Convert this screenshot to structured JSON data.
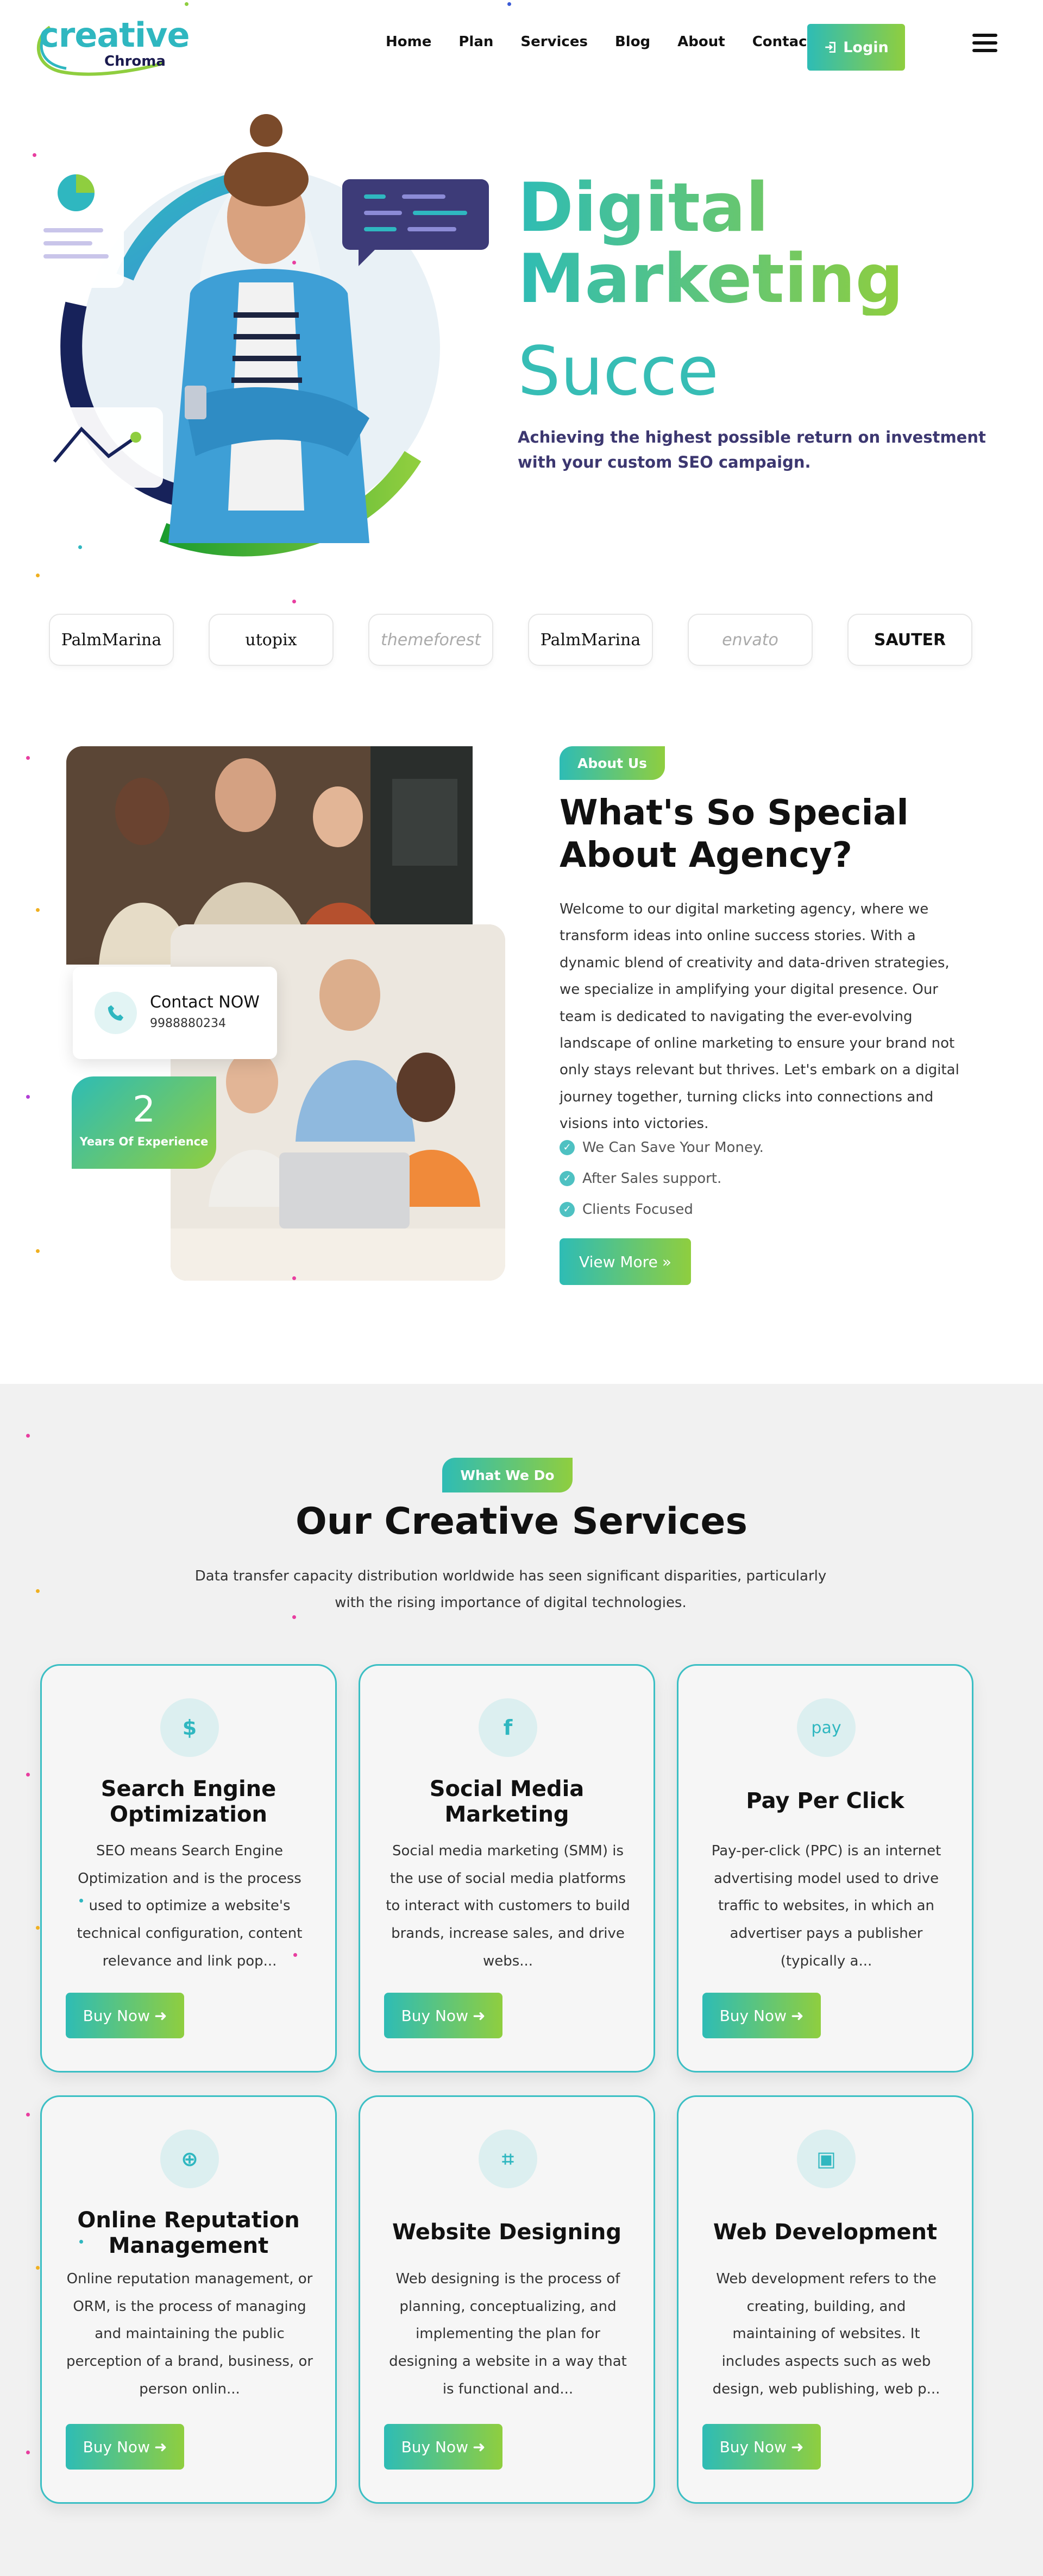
{
  "header": {
    "logo_main": "creative",
    "logo_sub": "Chroma",
    "nav": [
      "Home",
      "Plan",
      "Services",
      "Blog",
      "About",
      "Contact"
    ],
    "login_label": "Login",
    "icons": {
      "login": "login-icon",
      "menu": "hamburger-menu-icon"
    }
  },
  "hero": {
    "title_line1": "Digital",
    "title_line2": "Marketing",
    "typed_text": "Succe",
    "subtitle": "Achieving the highest possible return on investment with your custom SEO campaign."
  },
  "brands": [
    "PalmMarina",
    "utopix",
    "themeforest",
    "PalmMarina",
    "envato",
    "SAUTER"
  ],
  "about": {
    "pill": "About Us",
    "title": "What's So Special About Agency?",
    "text": "Welcome to our digital marketing agency, where we transform ideas into online success stories. With a dynamic blend of creativity and data-driven strategies, we specialize in amplifying your digital presence. Our team is dedicated to navigating the ever-evolving landscape of online marketing to ensure your brand not only stays relevant but thrives. Let's embark on a digital journey together, turning clicks into connections and visions into victories.",
    "checklist": [
      "We Can Save Your Money.",
      "After Sales support.",
      "Clients Focused"
    ],
    "button": "View More",
    "contact_title": "Contact NOW",
    "contact_phone": "9988880234",
    "experience_number": "2",
    "experience_label": "Years Of Experience"
  },
  "services": {
    "pill": "What We Do",
    "title": "Our Creative Services",
    "subtitle": "Data transfer capacity distribution worldwide has seen significant disparities, particularly with the rising importance of digital technologies.",
    "buy_label": "Buy Now",
    "cards": [
      {
        "icon": "seo-search-dollar-icon",
        "glyph": "$",
        "title": "Search Engine Optimization",
        "desc": "SEO means Search Engine Optimization and is the process used to optimize a website's technical configuration, content relevance and link pop..."
      },
      {
        "icon": "facebook-icon",
        "glyph": "f",
        "title": "Social Media Marketing",
        "desc": "Social media marketing (SMM) is the use of social media platforms to interact with customers to build brands, increase sales, and drive webs..."
      },
      {
        "icon": "amazon-pay-icon",
        "glyph": "pay",
        "title": "Pay Per Click",
        "desc": "Pay-per-click (PPC) is an internet advertising model used to drive traffic to websites, in which an advertiser pays a publisher (typically a..."
      },
      {
        "icon": "globe-icon",
        "glyph": "⊕",
        "title": "Online Reputation Management",
        "desc": "Online reputation management, or ORM, is the process of managing and maintaining the public perception of a brand, business, or person onlin..."
      },
      {
        "icon": "crop-icon",
        "glyph": "⌗",
        "title": "Website Designing",
        "desc": "Web designing is the process of planning, conceptualizing, and implementing the plan for designing a website in a way that is functional and..."
      },
      {
        "icon": "monitor-code-icon",
        "glyph": "▣",
        "title": "Web Development",
        "desc": "Web development refers to the creating, building, and maintaining of websites. It includes aspects such as web design, web publishing, web p..."
      }
    ]
  },
  "colors": {
    "teal": "#2ebcb5",
    "green": "#8fce3f",
    "navy": "#3c3770",
    "card_border": "#3bbfc4",
    "section_bg": "#f1f1f1"
  }
}
